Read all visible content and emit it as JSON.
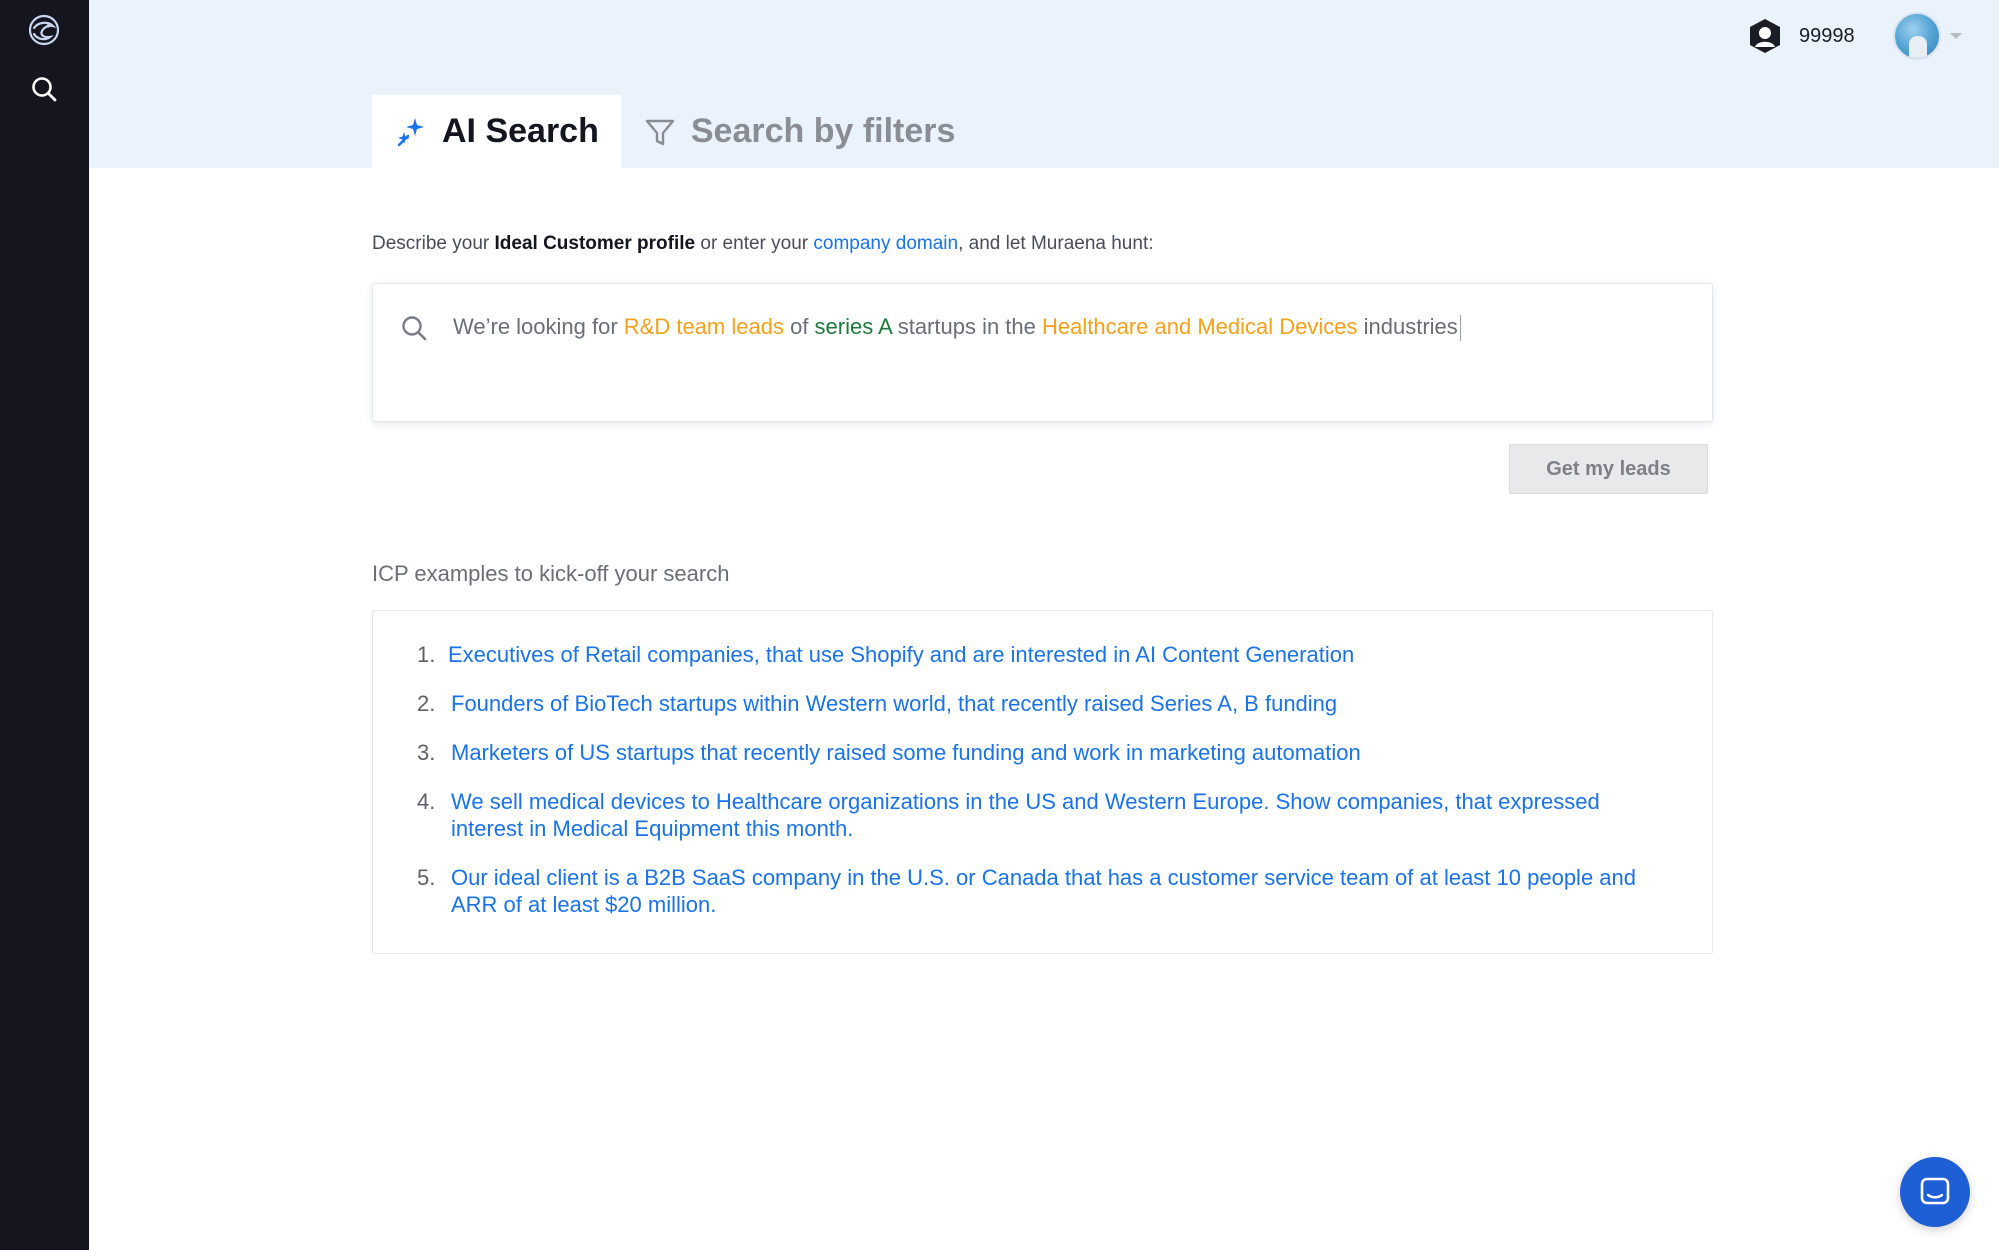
{
  "sidebar": {
    "logo_icon": "muraena-logo-icon",
    "search_icon": "search-icon"
  },
  "header": {
    "credits_icon": "credits-shield-icon",
    "credits_value": "99998",
    "avatar_icon": "user-avatar",
    "menu_icon": "chevron-down-icon"
  },
  "tabs": [
    {
      "label": "AI Search",
      "icon": "sparkles-icon",
      "active": true
    },
    {
      "label": "Search by filters",
      "icon": "filter-icon",
      "active": false
    }
  ],
  "describe": {
    "part1": "Describe your ",
    "ideal": "Ideal Customer profile",
    "part2": " or enter your ",
    "domain_link": "company domain",
    "part3": ", and let Muraena hunt:"
  },
  "search": {
    "t1": "We’re looking for ",
    "h1": "R&D team leads",
    "t2": " of ",
    "h2": "series A",
    "t3": " startups in the ",
    "h3": "Healthcare and Medical Devices",
    "t4": " industries"
  },
  "get_leads_label": "Get my leads",
  "icp": {
    "title": "ICP examples to kick-off your search",
    "items": [
      {
        "num": "1.",
        "text": "Executives of Retail companies, that use Shopify and are interested in AI Content Generation"
      },
      {
        "num": "2.",
        "text": "Founders of BioTech startups within Western world, that recently raised Series A, B funding"
      },
      {
        "num": "3.",
        "text": "Marketers of US startups that recently raised some funding and work in marketing automation"
      },
      {
        "num": "4.",
        "text": "We sell medical devices to Healthcare organizations in the US and Western Europe. Show companies, that expressed interest in Medical Equipment this month."
      },
      {
        "num": "5.",
        "text": "Our ideal client is a B2B SaaS company in the U.S. or Canada that has a customer service team of at least 10 people and ARR of at least $20 million."
      }
    ]
  },
  "colors": {
    "sidebar": "#14151f",
    "accent": "#1a73e8",
    "highlight_orange": "#f5a11a",
    "highlight_green": "#1e7a3c",
    "chat_button": "#1f5fd6"
  }
}
